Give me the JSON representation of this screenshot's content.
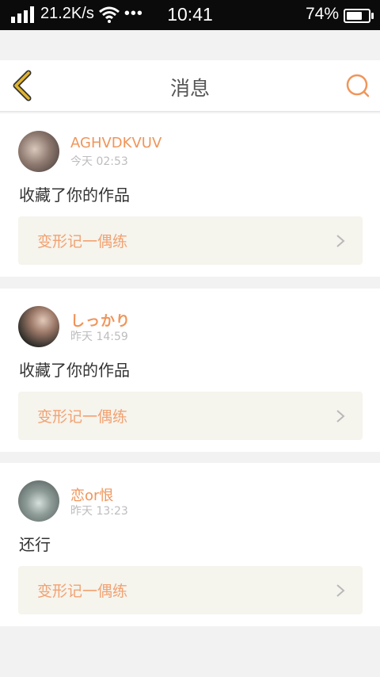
{
  "status_bar": {
    "network_speed": "21.2K/s",
    "more": "•••",
    "time": "10:41",
    "battery_percent": "74%",
    "battery_level": 0.74
  },
  "nav": {
    "title": "消息",
    "back_icon": "chevron-left-icon",
    "search_icon": "search-icon"
  },
  "messages": [
    {
      "username": "AGHVDKVUV",
      "time": "今天 02:53",
      "action": "收藏了你的作品",
      "work": "变形记一偶练"
    },
    {
      "username": "しっかり",
      "time": "昨天 14:59",
      "action": "收藏了你的作品",
      "work": "变形记一偶练"
    },
    {
      "username": "恋or恨",
      "time": "昨天 13:23",
      "action": "还行",
      "work": "变形记一偶练"
    }
  ],
  "colors": {
    "accent": "#f0955a",
    "back_icon": "#e3b52a",
    "link_bg": "#f5f4ed"
  }
}
